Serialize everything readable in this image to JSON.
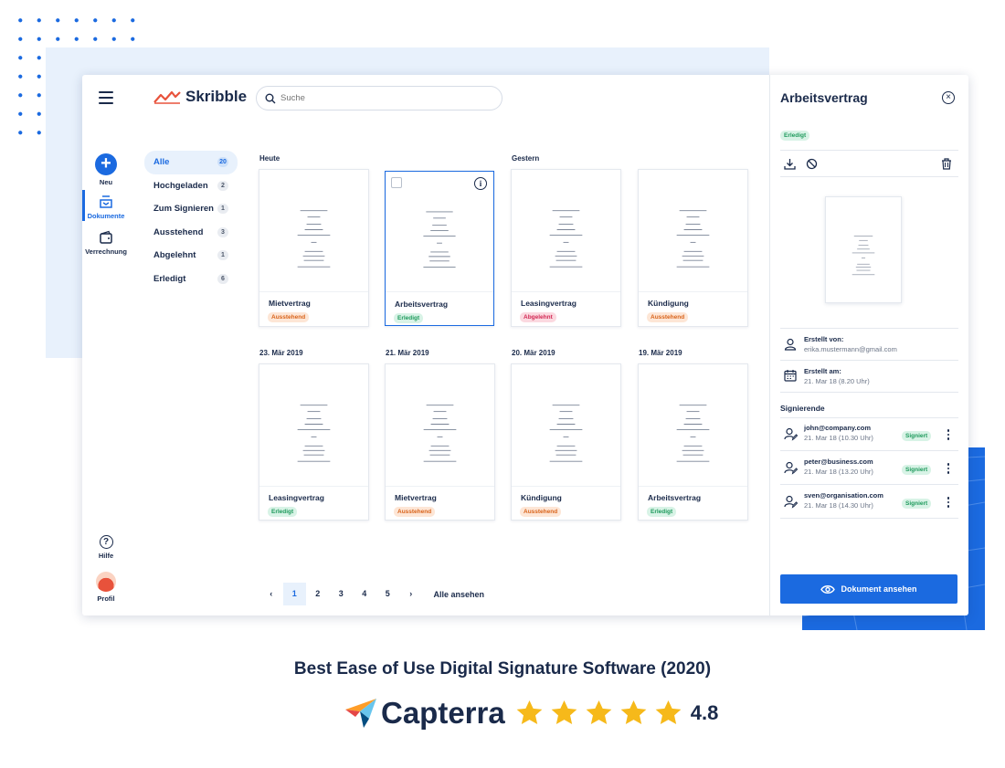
{
  "app": {
    "name": "Skribble"
  },
  "search": {
    "placeholder": "Suche"
  },
  "rail": {
    "new_label": "Neu",
    "documents_label": "Dokumente",
    "billing_label": "Verrechnung",
    "help_label": "Hilfe",
    "profile_label": "Profil"
  },
  "filters": [
    {
      "label": "Alle",
      "count": "20"
    },
    {
      "label": "Hochgeladen",
      "count": "2"
    },
    {
      "label": "Zum Signieren",
      "count": "1"
    },
    {
      "label": "Ausstehend",
      "count": "3"
    },
    {
      "label": "Abgelehnt",
      "count": "1"
    },
    {
      "label": "Erledigt",
      "count": "6"
    }
  ],
  "groups": {
    "today": "Heute",
    "yesterday": "Gestern",
    "d1": "23. Mär 2019",
    "d2": "21. Mär 2019",
    "d3": "20. Mär 2019",
    "d4": "19. Mär 2019"
  },
  "documents": [
    {
      "name": "Mietvertrag",
      "status": "Ausstehend"
    },
    {
      "name": "Arbeitsvertrag",
      "status": "Erledigt"
    },
    {
      "name": "Leasingvertrag",
      "status": "Abgelehnt"
    },
    {
      "name": "Kündigung",
      "status": "Ausstehend"
    },
    {
      "name": "Leasingvertrag",
      "status": "Erledigt"
    },
    {
      "name": "Mietvertrag",
      "status": "Ausstehend"
    },
    {
      "name": "Kündigung",
      "status": "Ausstehend"
    },
    {
      "name": "Arbeitsvertrag",
      "status": "Erledigt"
    }
  ],
  "pagination": {
    "pages": [
      "1",
      "2",
      "3",
      "4",
      "5"
    ],
    "current": "1",
    "all_label": "Alle ansehen"
  },
  "panel": {
    "title": "Arbeitsvertrag",
    "status": "Erledigt",
    "created_by_label": "Erstellt von:",
    "created_by_value": "erika.mustermann@gmail.com",
    "created_at_label": "Erstellt am:",
    "created_at_value": "21. Mar 18 (8.20 Uhr)",
    "signers_label": "Signierende",
    "signers": [
      {
        "email": "john@company.com",
        "date": "21. Mar 18 (10.30 Uhr)",
        "status": "Signiert"
      },
      {
        "email": "peter@business.com",
        "date": "21. Mar 18 (13.20 Uhr)",
        "status": "Signiert"
      },
      {
        "email": "sven@organisation.com",
        "date": "21. Mar 18 (14.30 Uhr)",
        "status": "Signiert"
      }
    ],
    "cta_label": "Dokument ansehen"
  },
  "award": {
    "text": "Best Ease of Use Digital Signature Software (2020)",
    "brand": "Capterra",
    "rating": "4.8",
    "stars": 5
  },
  "colors": {
    "accent": "#1b6ae0",
    "dark": "#1a2a4a",
    "pending": "#d9631a",
    "done": "#1e9a5c",
    "rejected": "#d22954",
    "brand_logo": "#e8523b",
    "star": "#f6b91a"
  }
}
